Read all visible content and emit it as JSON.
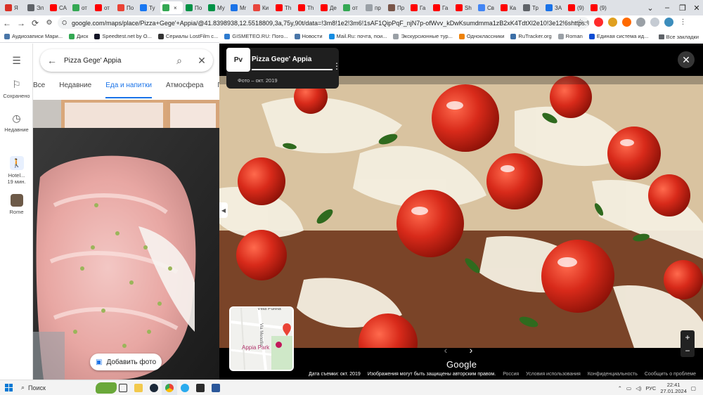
{
  "browser": {
    "tabs": [
      {
        "label": "Я",
        "color": "#d93025"
      },
      {
        "label": "Эл",
        "color": "#5f6368"
      },
      {
        "label": "СА",
        "color": "#ff0000"
      },
      {
        "label": "от",
        "color": "#34a853"
      },
      {
        "label": "от",
        "color": "#ff0000"
      },
      {
        "label": "По",
        "color": "#ea4335"
      },
      {
        "label": "Ту",
        "color": "#1877f2"
      },
      {
        "label": "",
        "color": "#34a853",
        "active": true
      },
      {
        "label": "По",
        "color": "#009246"
      },
      {
        "label": "Му",
        "color": "#009246"
      },
      {
        "label": "Mr",
        "color": "#1a73e8"
      },
      {
        "label": "Ки",
        "color": "#e8453c"
      },
      {
        "label": "Th",
        "color": "#ff0000"
      },
      {
        "label": "Th",
        "color": "#ff0000"
      },
      {
        "label": "Де",
        "color": "#ff0000"
      },
      {
        "label": "от",
        "color": "#34a853"
      },
      {
        "label": "пр",
        "color": "#9aa0a6"
      },
      {
        "label": "Пр",
        "color": "#795548"
      },
      {
        "label": "Га",
        "color": "#ff0000"
      },
      {
        "label": "Га",
        "color": "#ff0000"
      },
      {
        "label": "Sh",
        "color": "#ff0000"
      },
      {
        "label": "Св",
        "color": "#4285f4"
      },
      {
        "label": "Ка",
        "color": "#ff0000"
      },
      {
        "label": "Тр",
        "color": "#5f6368"
      },
      {
        "label": "ЗА",
        "color": "#1a73e8"
      },
      {
        "label": "(9)",
        "color": "#ff0000"
      },
      {
        "label": "(9)",
        "color": "#ff0000"
      }
    ],
    "url": "google.com/maps/place/Pizza+Gege'+Appia/@41.8398938,12.5518809,3a,75y,90t/data=!3m8!1e2!3m6!1sAF1QipPqF_njN7p-ofWvv_kDwKsumdmma1zB2xK4TdtXl2e10!3e12!6shttps:%2F%2Flh5.googleuser...",
    "bookmarks": [
      {
        "label": "Аудиозаписи Мари...",
        "color": "#4a76a8"
      },
      {
        "label": "Диск",
        "color": "#34a853"
      },
      {
        "label": "Speedtest.net by O...",
        "color": "#141526"
      },
      {
        "label": "Сериалы LostFilm с...",
        "color": "#333333"
      },
      {
        "label": "GISMETEO.RU: Пого...",
        "color": "#2e7bcf"
      },
      {
        "label": "Новости",
        "color": "#4a76a8"
      },
      {
        "label": "Mail.Ru: почта, пои...",
        "color": "#168de2"
      },
      {
        "label": "Экскурсионные тур...",
        "color": "#9aa0a6"
      },
      {
        "label": "Одноклассники",
        "color": "#ee8208"
      },
      {
        "label": "RuTracker.org",
        "color": "#3c6fa7"
      },
      {
        "label": "Roman",
        "color": "#9aa0a6"
      },
      {
        "label": "Единая система ид...",
        "color": "#0d4cd3"
      },
      {
        "label": "Новая папка",
        "color": "#f2c94c"
      }
    ],
    "all_bookmarks": "Все закладки"
  },
  "rail": {
    "saved": "Сохранено",
    "recent": "Недавние",
    "hotel": "Hotel...",
    "hotel_time": "19 мин.",
    "rome": "Rome"
  },
  "search": {
    "query": "Pizza Gege' Appia"
  },
  "chips": [
    "Все",
    "Недавние",
    "Еда и напитки",
    "Атмосфера",
    "Пи"
  ],
  "add_photo": "Добавить фото",
  "viewer": {
    "avatar_text": "Рv",
    "title": "Pizza Gege' Appia",
    "subtitle": "Фото – окт. 2019",
    "map_labels": {
      "street1": "Villa Fulvia",
      "street2": "Via Menofilo",
      "park": "Appia Park"
    },
    "logo": "Google",
    "footer": {
      "date": "Дата съемки: окт. 2019",
      "copyright": "Изображения могут быть защищены авторским правом.",
      "country": "Россия",
      "terms": "Условия использования",
      "privacy": "Конфиденциальность",
      "report": "Сообщить о проблеме"
    }
  },
  "taskbar": {
    "search": "Поиск",
    "lang": "РУС",
    "time": "22:41",
    "date": "27.01.2024"
  }
}
